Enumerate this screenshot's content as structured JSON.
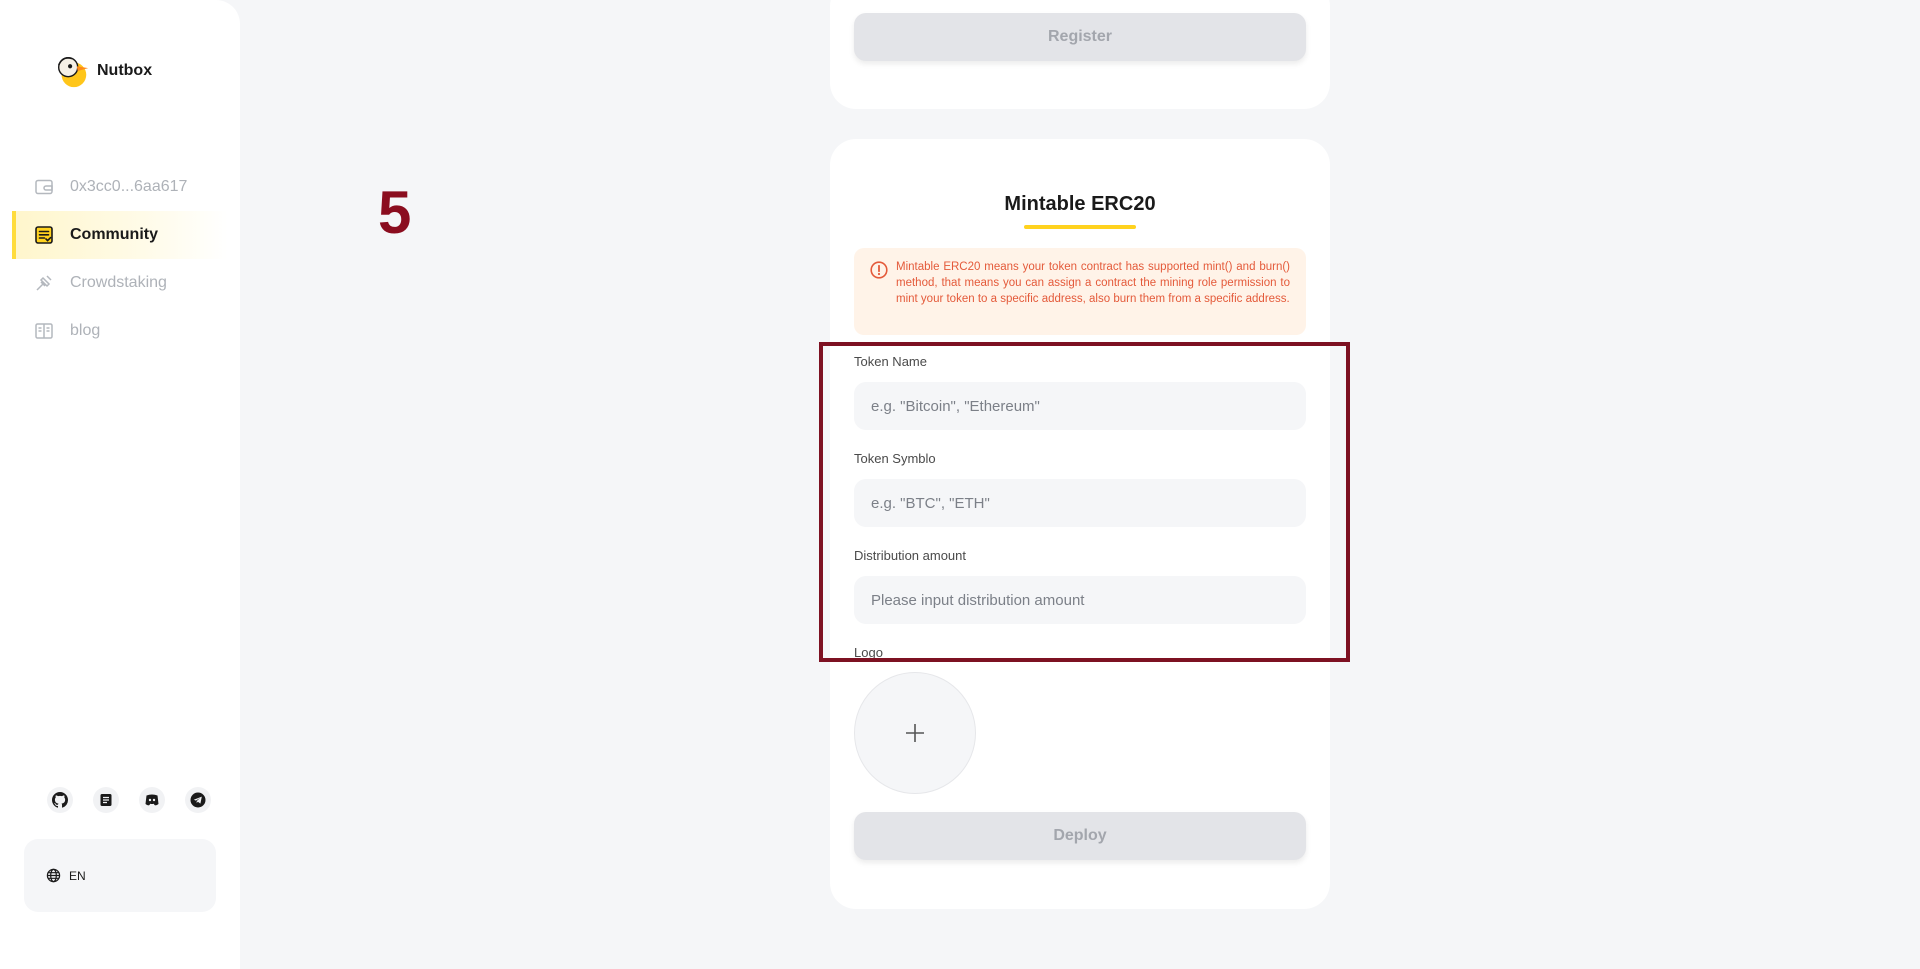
{
  "app": {
    "name": "Nutbox"
  },
  "sidebar": {
    "items": [
      {
        "label": "0x3cc0...6aa617",
        "icon": "wallet-icon"
      },
      {
        "label": "Community",
        "icon": "community-icon",
        "active": true
      },
      {
        "label": "Crowdstaking",
        "icon": "crowdstaking-icon"
      },
      {
        "label": "blog",
        "icon": "blog-icon"
      }
    ],
    "socials": [
      "github-icon",
      "document-icon",
      "discord-icon",
      "telegram-icon"
    ],
    "language": "EN"
  },
  "step_marker": "5",
  "register_card": {
    "button_label": "Register"
  },
  "erc20_card": {
    "title": "Mintable ERC20",
    "warning": "Mintable ERC20 means your token contract has supported mint() and burn() method, that means you can assign a contract the mining role permission to mint your token to a specific address, also burn them from a specific address.",
    "fields": {
      "token_name": {
        "label": "Token Name",
        "placeholder": "e.g. \"Bitcoin\", \"Ethereum\""
      },
      "token_symbol": {
        "label": "Token Symblo",
        "placeholder": "e.g. \"BTC\", \"ETH\""
      },
      "distribution_amount": {
        "label": "Distribution amount",
        "placeholder": "Please input distribution amount"
      },
      "logo": {
        "label": "Logo"
      }
    },
    "deploy_label": "Deploy"
  },
  "colors": {
    "accent": "#ffd21e",
    "warning_text": "#e45a3a",
    "warning_bg": "#fff3e8",
    "highlight": "#7d1122"
  }
}
